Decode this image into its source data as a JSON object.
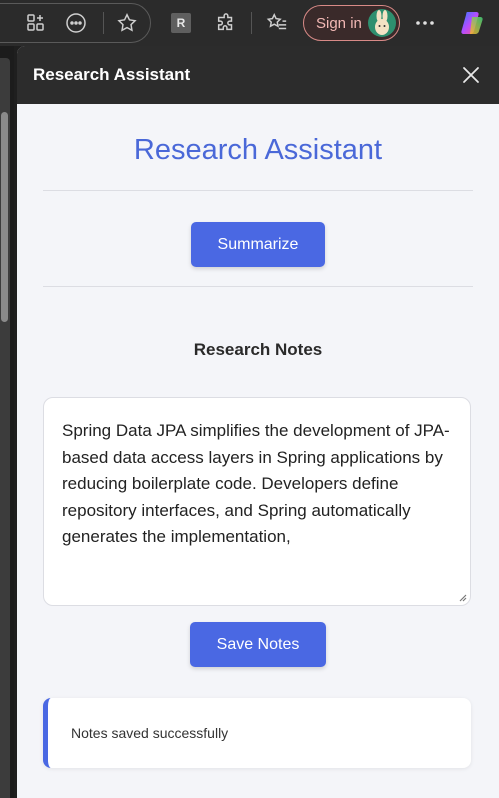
{
  "browser": {
    "signin_label": "Sign in",
    "reading_badge": "R",
    "icons": [
      "split-screen-icon",
      "more-options-circle-icon",
      "favorite-star-icon",
      "extensions-icon",
      "favorites-list-icon",
      "more-menu-icon",
      "copilot-icon"
    ]
  },
  "panel": {
    "header_title": "Research Assistant"
  },
  "app": {
    "title": "Research Assistant",
    "summarize_label": "Summarize",
    "notes_heading": "Research Notes",
    "notes_text": "Spring Data JPA simplifies the development of JPA-based data access layers in Spring applications by reducing boilerplate code. Developers define repository interfaces, and Spring automatically generates the implementation,",
    "save_label": "Save Notes",
    "toast_message": "Notes saved successfully"
  },
  "colors": {
    "accent": "#4a68e3",
    "title": "#4a68d8",
    "panel_bg": "#f4f5f9",
    "header_bg": "#2c2c2c"
  }
}
